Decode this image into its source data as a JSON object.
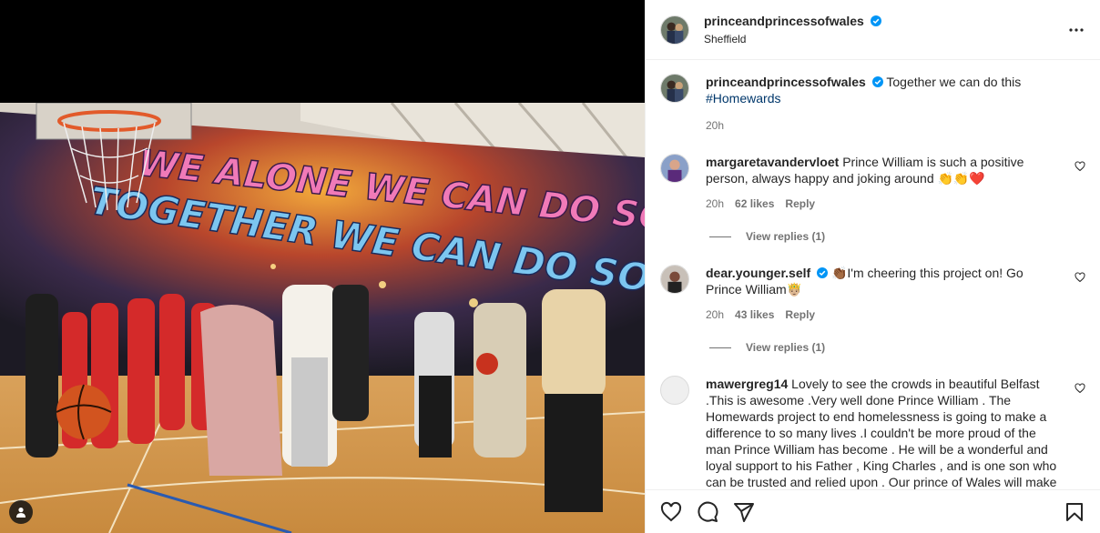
{
  "post": {
    "username": "princeandprincessofwales",
    "location": "Sheffield",
    "caption_text": "Together we can do this",
    "caption_hashtag": "#Homewards",
    "time": "20h"
  },
  "comments": [
    {
      "username": "margaretavandervloet",
      "text": "Prince William is such a positive person, always happy and joking around 👏👏❤️",
      "time": "20h",
      "likes": "62 likes",
      "reply": "Reply",
      "view_replies": "View replies (1)"
    },
    {
      "username": "dear.younger.self",
      "text": "👏🏾I'm cheering this project on! Go Prince William🤴🏼",
      "time": "20h",
      "likes": "43 likes",
      "reply": "Reply",
      "view_replies": "View replies (1)"
    },
    {
      "username": "mawergreg14",
      "text": "Lovely to see the crowds in beautiful Belfast .This is awesome .Very well done Prince William . The Homewards project to end homelessness is going to make a difference to so many lives .I couldn't be more proud of the man Prince William has become . He will be a wonderful and loyal support to his Father , King Charles , and is one son who can be trusted and relied upon . Our prince of Wales will make a fine king one day , With His dedication to duty , his loyalty"
    }
  ],
  "photo": {
    "mural_line1": "WE ALONE WE CAN DO SO LITTLE!",
    "mural_line2": "TOGETHER WE CAN DO SO MUCH!"
  },
  "colors": {
    "verified": "#0095f6",
    "hashtag": "#00376b",
    "muted": "#737373",
    "like_red": "#ed4956"
  }
}
